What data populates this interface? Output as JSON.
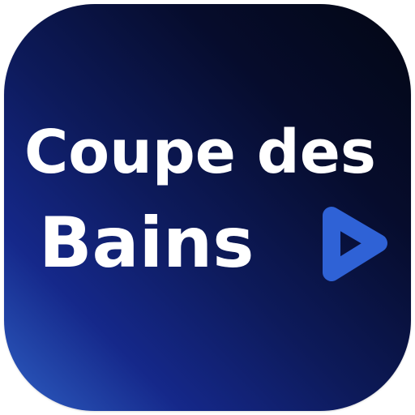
{
  "icon": {
    "title_line1": "Coupe des",
    "title_line2": "Bains",
    "play_icon": "play-triangle-icon",
    "colors": {
      "text": "#ffffff",
      "play_accent": "#2f62d6",
      "background_dark": "#060c2c",
      "background_light": "#2e5fc4"
    }
  }
}
